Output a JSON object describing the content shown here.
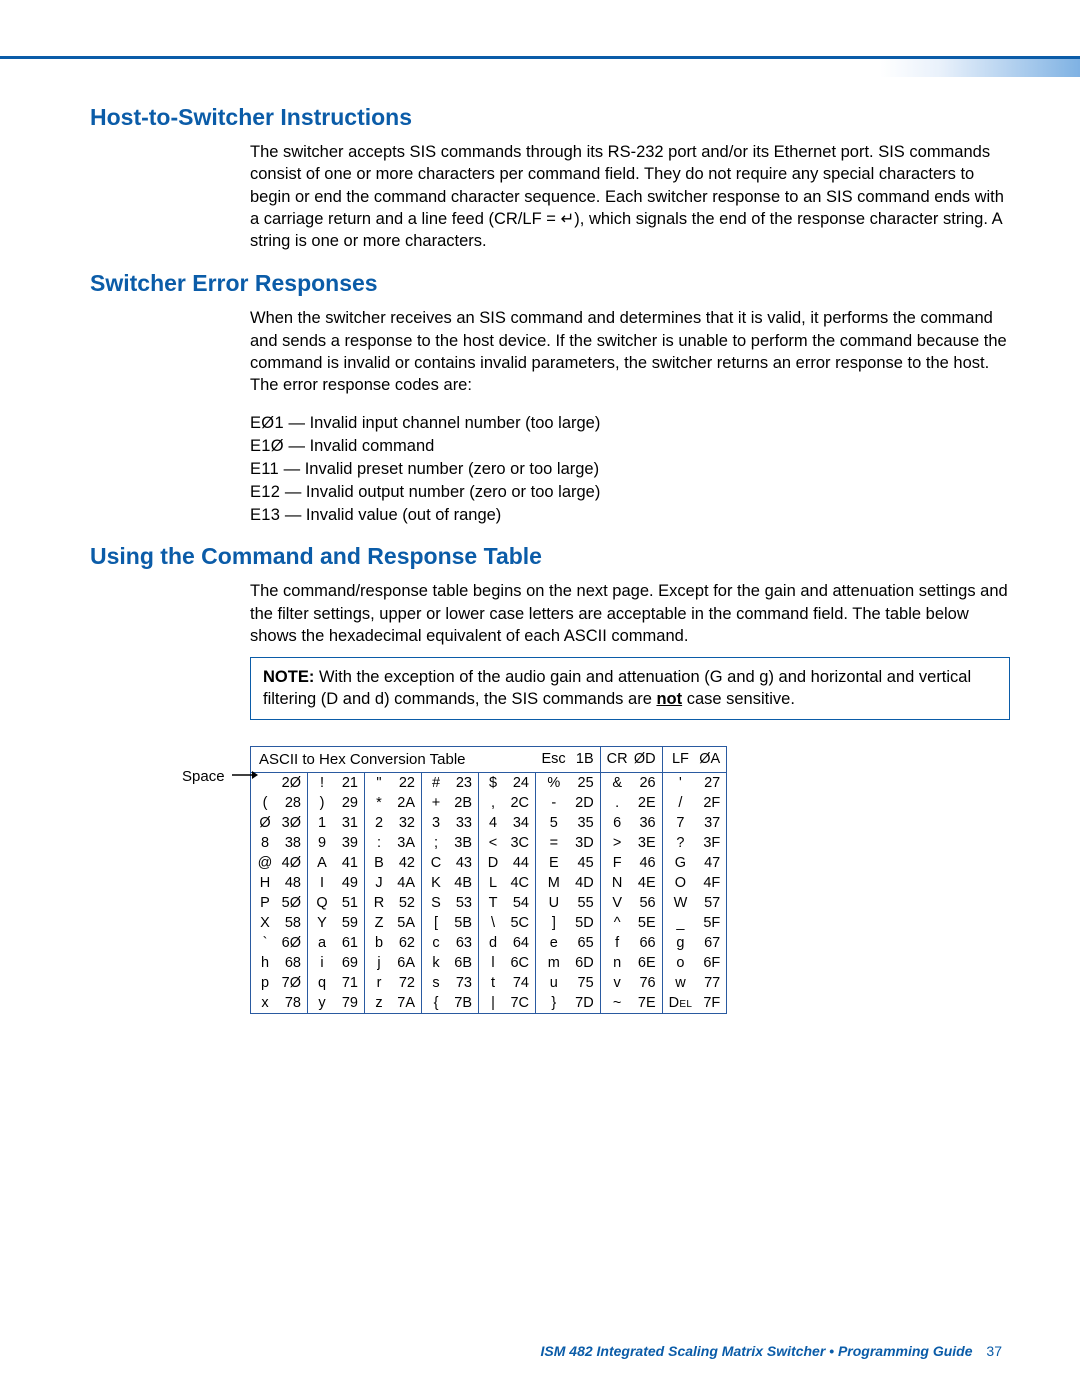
{
  "sections": {
    "host": {
      "title": "Host-to-Switcher Instructions",
      "para": "The switcher accepts SIS commands through its RS-232 port and/or its Ethernet port.  SIS commands consist of one or more characters per command field.  They do not require any special characters to begin or end the command character sequence.  Each switcher response to an SIS command ends with a carriage return and a line feed (CR/LF = ↵), which signals the end of the response character string.  A string is one or more characters."
    },
    "err": {
      "title": "Switcher Error Responses",
      "para": "When the switcher receives an SIS command and determines that it is valid, it performs the command and sends a response to the host device.  If the switcher is unable to perform the command because the command is invalid or contains invalid parameters, the switcher returns an error response to the host.  The error response codes are:",
      "codes": [
        {
          "code": "E01",
          "desc": "Invalid input channel number (too large)"
        },
        {
          "code": "E10",
          "desc": "Invalid command"
        },
        {
          "code": "E11",
          "desc": "Invalid preset number (zero or too large)"
        },
        {
          "code": "E12",
          "desc": "Invalid output number (zero or too large)"
        },
        {
          "code": "E13",
          "desc": "Invalid value (out of range)"
        }
      ]
    },
    "cmd": {
      "title": "Using the Command and Response Table",
      "para": "The command/response table begins on the next page. Except for the gain and attenuation settings and the filter settings, upper or lower case letters are acceptable in the command field. The table below shows the hexadecimal equivalent of each ASCII command.",
      "note_label": "NOTE:",
      "note_pre": "With the exception of the audio gain and attenuation (",
      "note_G": "G",
      "note_and1": " and ",
      "note_g": "g",
      "note_mid": ") and horizontal and vertical filtering (",
      "note_D": "D",
      "note_and2": " and ",
      "note_d": "d",
      "note_post1": ") commands, the SIS commands are ",
      "note_not": "not",
      "note_post2": " case sensitive."
    }
  },
  "ascii": {
    "title": "ASCII to Hex  Conversion Table",
    "header_extra": [
      {
        "ch": "Esc",
        "hx": "1B"
      },
      {
        "ch": "CR",
        "hx": "0D"
      },
      {
        "ch": "LF",
        "hx": "0A"
      }
    ],
    "space_label": "Space",
    "rows": [
      [
        {
          "ch": " ",
          "hx": "20"
        },
        {
          "ch": "!",
          "hx": "21"
        },
        {
          "ch": "\"",
          "hx": "22"
        },
        {
          "ch": "#",
          "hx": "23"
        },
        {
          "ch": "$",
          "hx": "24"
        },
        {
          "ch": "%",
          "hx": "25"
        },
        {
          "ch": "&",
          "hx": "26"
        },
        {
          "ch": "'",
          "hx": "27"
        }
      ],
      [
        {
          "ch": "(",
          "hx": "28"
        },
        {
          "ch": ")",
          "hx": "29"
        },
        {
          "ch": "*",
          "hx": "2A"
        },
        {
          "ch": "+",
          "hx": "2B"
        },
        {
          "ch": ",",
          "hx": "2C"
        },
        {
          "ch": "-",
          "hx": "2D"
        },
        {
          "ch": ".",
          "hx": "2E"
        },
        {
          "ch": "/",
          "hx": "2F"
        }
      ],
      [
        {
          "ch": "0",
          "hx": "30"
        },
        {
          "ch": "1",
          "hx": "31"
        },
        {
          "ch": "2",
          "hx": "32"
        },
        {
          "ch": "3",
          "hx": "33"
        },
        {
          "ch": "4",
          "hx": "34"
        },
        {
          "ch": "5",
          "hx": "35"
        },
        {
          "ch": "6",
          "hx": "36"
        },
        {
          "ch": "7",
          "hx": "37"
        }
      ],
      [
        {
          "ch": "8",
          "hx": "38"
        },
        {
          "ch": "9",
          "hx": "39"
        },
        {
          "ch": ":",
          "hx": "3A"
        },
        {
          "ch": ";",
          "hx": "3B"
        },
        {
          "ch": "<",
          "hx": "3C"
        },
        {
          "ch": "=",
          "hx": "3D"
        },
        {
          "ch": ">",
          "hx": "3E"
        },
        {
          "ch": "?",
          "hx": "3F"
        }
      ],
      [
        {
          "ch": "@",
          "hx": "40"
        },
        {
          "ch": "A",
          "hx": "41"
        },
        {
          "ch": "B",
          "hx": "42"
        },
        {
          "ch": "C",
          "hx": "43"
        },
        {
          "ch": "D",
          "hx": "44"
        },
        {
          "ch": "E",
          "hx": "45"
        },
        {
          "ch": "F",
          "hx": "46"
        },
        {
          "ch": "G",
          "hx": "47"
        }
      ],
      [
        {
          "ch": "H",
          "hx": "48"
        },
        {
          "ch": "I",
          "hx": "49"
        },
        {
          "ch": "J",
          "hx": "4A"
        },
        {
          "ch": "K",
          "hx": "4B"
        },
        {
          "ch": "L",
          "hx": "4C"
        },
        {
          "ch": "M",
          "hx": "4D"
        },
        {
          "ch": "N",
          "hx": "4E"
        },
        {
          "ch": "O",
          "hx": "4F"
        }
      ],
      [
        {
          "ch": "P",
          "hx": "50"
        },
        {
          "ch": "Q",
          "hx": "51"
        },
        {
          "ch": "R",
          "hx": "52"
        },
        {
          "ch": "S",
          "hx": "53"
        },
        {
          "ch": "T",
          "hx": "54"
        },
        {
          "ch": "U",
          "hx": "55"
        },
        {
          "ch": "V",
          "hx": "56"
        },
        {
          "ch": "W",
          "hx": "57"
        }
      ],
      [
        {
          "ch": "X",
          "hx": "58"
        },
        {
          "ch": "Y",
          "hx": "59"
        },
        {
          "ch": "Z",
          "hx": "5A"
        },
        {
          "ch": "[",
          "hx": "5B"
        },
        {
          "ch": "\\",
          "hx": "5C"
        },
        {
          "ch": "]",
          "hx": "5D"
        },
        {
          "ch": "^",
          "hx": "5E"
        },
        {
          "ch": "_",
          "hx": "5F"
        }
      ],
      [
        {
          "ch": "`",
          "hx": "60"
        },
        {
          "ch": "a",
          "hx": "61"
        },
        {
          "ch": "b",
          "hx": "62"
        },
        {
          "ch": "c",
          "hx": "63"
        },
        {
          "ch": "d",
          "hx": "64"
        },
        {
          "ch": "e",
          "hx": "65"
        },
        {
          "ch": "f",
          "hx": "66"
        },
        {
          "ch": "g",
          "hx": "67"
        }
      ],
      [
        {
          "ch": "h",
          "hx": "68"
        },
        {
          "ch": "i",
          "hx": "69"
        },
        {
          "ch": "j",
          "hx": "6A"
        },
        {
          "ch": "k",
          "hx": "6B"
        },
        {
          "ch": "l",
          "hx": "6C"
        },
        {
          "ch": "m",
          "hx": "6D"
        },
        {
          "ch": "n",
          "hx": "6E"
        },
        {
          "ch": "o",
          "hx": "6F"
        }
      ],
      [
        {
          "ch": "p",
          "hx": "70"
        },
        {
          "ch": "q",
          "hx": "71"
        },
        {
          "ch": "r",
          "hx": "72"
        },
        {
          "ch": "s",
          "hx": "73"
        },
        {
          "ch": "t",
          "hx": "74"
        },
        {
          "ch": "u",
          "hx": "75"
        },
        {
          "ch": "v",
          "hx": "76"
        },
        {
          "ch": "w",
          "hx": "77"
        }
      ],
      [
        {
          "ch": "x",
          "hx": "78"
        },
        {
          "ch": "y",
          "hx": "79"
        },
        {
          "ch": "z",
          "hx": "7A"
        },
        {
          "ch": "{",
          "hx": "7B"
        },
        {
          "ch": "|",
          "hx": "7C"
        },
        {
          "ch": "}",
          "hx": "7D"
        },
        {
          "ch": "~",
          "hx": "7E"
        },
        {
          "ch": "Del",
          "hx": "7F"
        }
      ]
    ]
  },
  "footer": {
    "text": "ISM 482 Integrated Scaling Matrix Switcher • Programming Guide",
    "page": "37"
  }
}
